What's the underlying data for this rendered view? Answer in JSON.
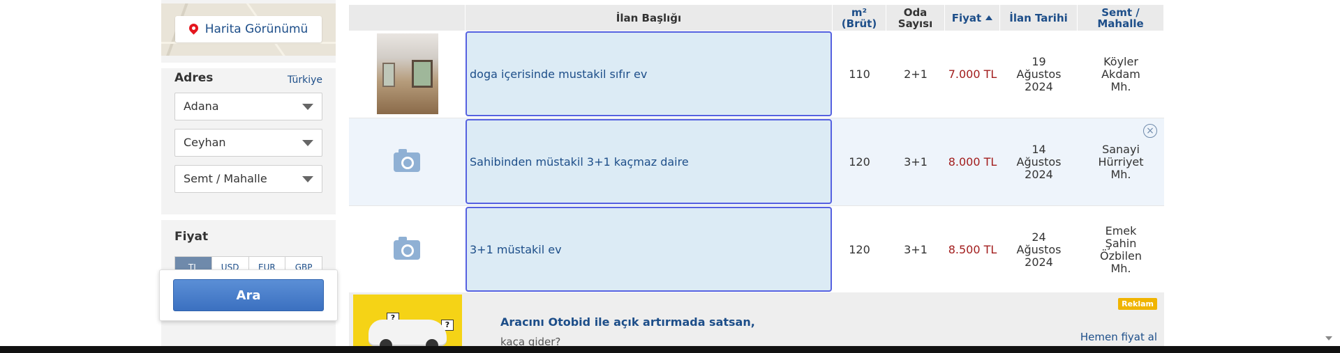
{
  "sidebar": {
    "map_button_label": "Harita Görünümü",
    "adres": {
      "title": "Adres",
      "country_link": "Türkiye",
      "selects": [
        {
          "value": "Adana"
        },
        {
          "value": "Ceyhan"
        },
        {
          "value": "Semt / Mahalle"
        }
      ]
    },
    "fiyat": {
      "title": "Fiyat",
      "currencies": [
        "TL",
        "USD",
        "EUR",
        "GBP"
      ]
    },
    "search_button_label": "Ara"
  },
  "table": {
    "headers": {
      "title": "İlan Başlığı",
      "area": "m² (Brüt)",
      "rooms": "Oda Sayısı",
      "price": "Fiyat",
      "date": "İlan Tarihi",
      "location": "Semt / Mahalle"
    },
    "rows": [
      {
        "title": "doga içerisinde mustakil sıfır ev",
        "area": "110",
        "rooms": "2+1",
        "price": "7.000 TL",
        "date": "19 Ağustos 2024",
        "location": "Köyler Akdam Mh.",
        "has_photo": true
      },
      {
        "title": "Sahibinden müstakil 3+1 kaçmaz daire",
        "area": "120",
        "rooms": "3+1",
        "price": "8.000 TL",
        "date": "14 Ağustos 2024",
        "location": "Sanayi Hürriyet Mh.",
        "has_photo": false
      },
      {
        "title": "3+1 müstakil ev",
        "area": "120",
        "rooms": "3+1",
        "price": "8.500 TL",
        "date": "24 Ağustos 2024",
        "location": "Emek Şahin Özbilen Mh.",
        "has_photo": false
      }
    ],
    "ad": {
      "badge": "Reklam",
      "title": "Aracını Otobid ile açık artırmada satsan,",
      "subtitle": "kaça gider?",
      "link": "Hemen fiyat al"
    }
  },
  "colors": {
    "link_blue": "#1d4e89",
    "price_red": "#a21d1d",
    "selected_outline": "#5561e0",
    "ad_yellow": "#f5d316"
  }
}
